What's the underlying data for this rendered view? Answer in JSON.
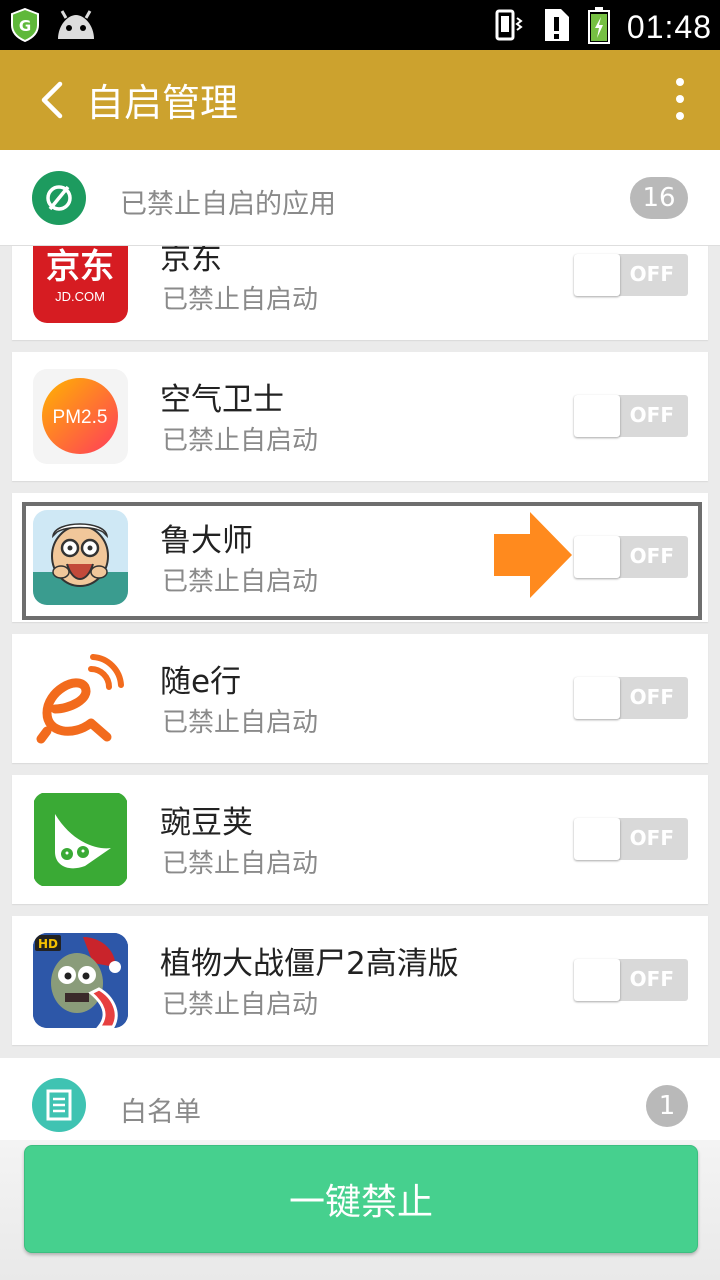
{
  "status_bar": {
    "time": "01:48",
    "icons": [
      "shield-app-icon",
      "android-icon",
      "vibrate-icon",
      "sim-alert-icon",
      "battery-charging-icon"
    ]
  },
  "app_bar": {
    "title": "自启管理",
    "back_icon": "chevron-left-icon",
    "menu_icon": "more-vertical-icon"
  },
  "section_header": {
    "label": "已禁止自启的应用",
    "count": "16",
    "icon": "forbidden-icon",
    "icon_color": "#1d9b5f"
  },
  "apps": [
    {
      "name": "京东",
      "status": "已禁止自启动",
      "toggle": "OFF",
      "icon": "jd-app-icon",
      "icon_text": "京东",
      "icon_subtext": "JD.COM"
    },
    {
      "name": "空气卫士",
      "status": "已禁止自启动",
      "toggle": "OFF",
      "icon": "pm25-app-icon",
      "icon_text": "PM2.5"
    },
    {
      "name": "鲁大师",
      "status": "已禁止自启动",
      "toggle": "OFF",
      "icon": "ludashi-app-icon"
    },
    {
      "name": "随e行",
      "status": "已禁止自启动",
      "toggle": "OFF",
      "icon": "suiexing-app-icon"
    },
    {
      "name": "豌豆荚",
      "status": "已禁止自启动",
      "toggle": "OFF",
      "icon": "wandoujia-app-icon"
    },
    {
      "name": "植物大战僵尸2高清版",
      "status": "已禁止自启动",
      "toggle": "OFF",
      "icon": "pvz2-app-icon",
      "icon_badge": "HD"
    }
  ],
  "whitelist": {
    "label": "白名单",
    "count": "1",
    "icon": "document-icon",
    "icon_color": "#3fc3b2"
  },
  "primary_button": {
    "label": "一键禁止",
    "color": "#46d08e"
  },
  "colors": {
    "app_bar": "#cca22e",
    "highlight_arrow": "#ff8a1e"
  }
}
